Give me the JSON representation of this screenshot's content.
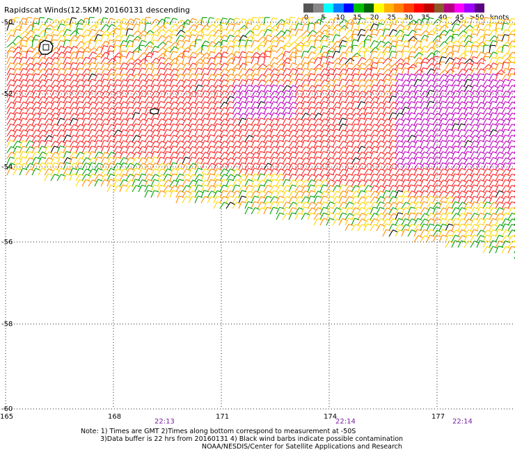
{
  "title": "Rapidscat Winds(12.5KM) 20160131 descending",
  "legend": {
    "labels": [
      "0",
      "5",
      "10",
      "15",
      "20",
      "25",
      "30",
      "35",
      "40",
      "45",
      ">50"
    ],
    "units": "knots",
    "swatch_colors": [
      "#555555",
      "#888888",
      "#00ffff",
      "#0080ff",
      "#0000ff",
      "#00c000",
      "#006400",
      "#ffff00",
      "#ffb400",
      "#ff7f00",
      "#ff4000",
      "#ff0000",
      "#c00000",
      "#8b5a2b",
      "#b4007f",
      "#ff00ff",
      "#a000ff",
      "#5a0080"
    ]
  },
  "axes": {
    "latitude_labels": [
      "-50",
      "-52",
      "-54",
      "-56",
      "-58",
      "-60"
    ],
    "longitude_labels": [
      "165",
      "168",
      "171",
      "174",
      "177"
    ]
  },
  "pass_times": [
    "22:13",
    "22:14",
    "22:14"
  ],
  "notes": {
    "line1": "Note: 1) Times are GMT 2)Times along bottom correspond to measurement at -50S",
    "line2": "3)Data buffer is 22 hrs from 20160131 4) Black wind barbs indicate possible contamination",
    "line3": "NOAA/NESDIS/Center for Satellite Applications and Research"
  },
  "colors": {
    "time_label": "#7a1fa2",
    "barb_weak": "#00a000",
    "barb_light": "#ffd700",
    "barb_moderate": "#ff8c00",
    "barb_strong": "#ff2020",
    "barb_gale": "#c000c0",
    "barb_contaminated": "#000000"
  }
}
